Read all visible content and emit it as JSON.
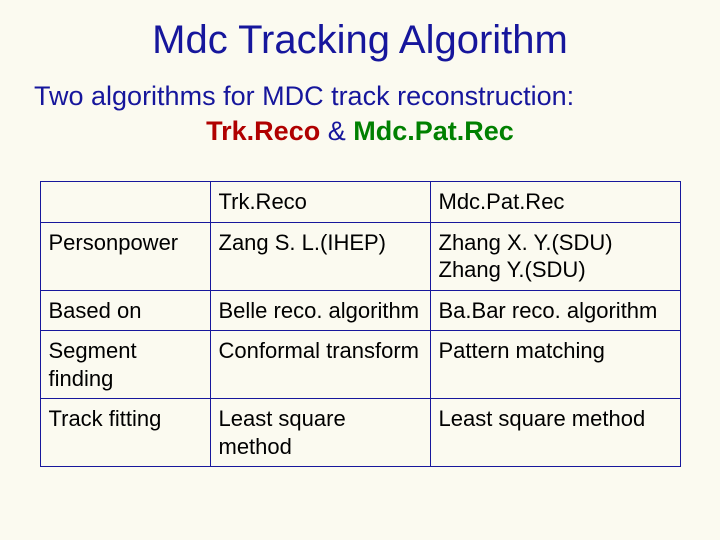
{
  "title": "Mdc Tracking Algorithm",
  "intro": "Two algorithms for MDC track reconstruction:",
  "algoA": "Trk.Reco",
  "amp": "&",
  "algoB": "Mdc.Pat.Rec",
  "table": {
    "head": {
      "r": "",
      "a": "Trk.Reco",
      "b": "Mdc.Pat.Rec"
    },
    "rows": [
      {
        "r": "Personpower",
        "a": "Zang S. L.(IHEP)",
        "b": "Zhang X. Y.(SDU)\nZhang Y.(SDU)"
      },
      {
        "r": "Based on",
        "a": "Belle reco.\nalgorithm",
        "b": "Ba.Bar reco.\nalgorithm"
      },
      {
        "r": "Segment\nfinding",
        "a": "Conformal\ntransform",
        "b": "Pattern matching"
      },
      {
        "r": "Track fitting",
        "a": "Least square\nmethod",
        "b": "Least square\nmethod"
      }
    ]
  }
}
